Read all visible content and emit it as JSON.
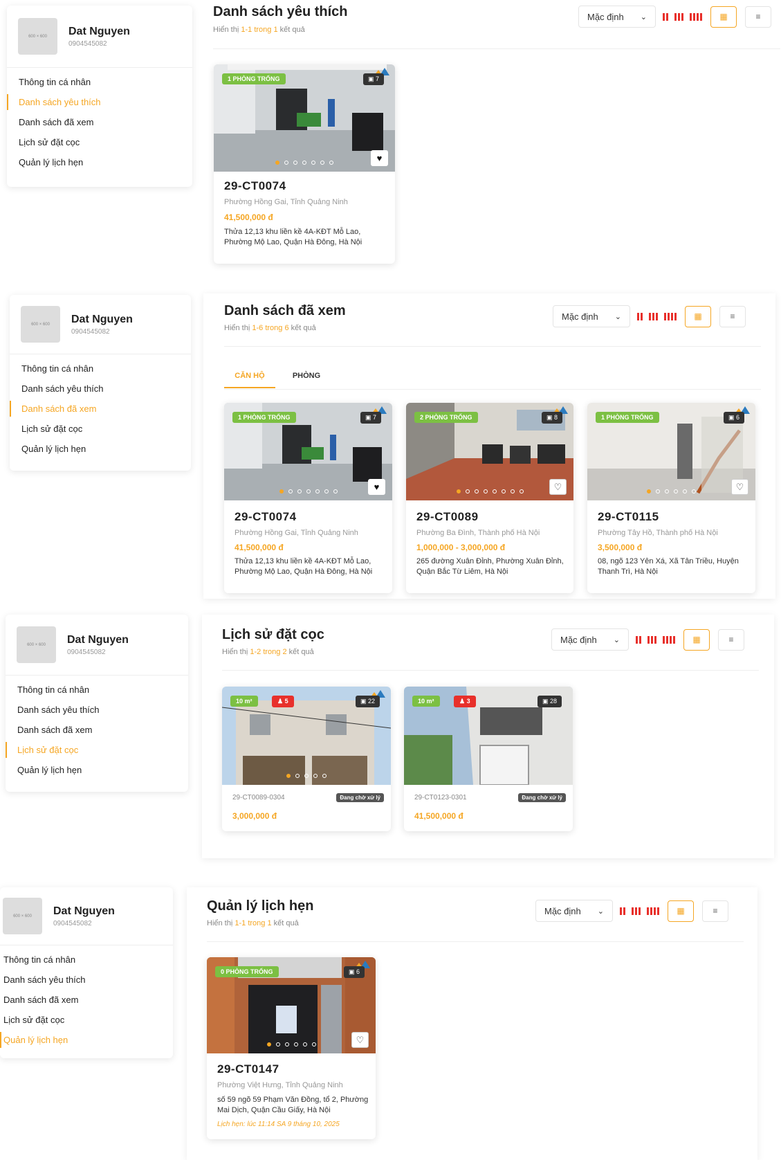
{
  "profile": {
    "name": "Dat Nguyen",
    "phone": "0904545082",
    "avatar_text": "600 × 600"
  },
  "menu": [
    "Thông tin cá nhân",
    "Danh sách yêu thích",
    "Danh sách đã xem",
    "Lịch sử đặt cọc",
    "Quản lý lịch hẹn"
  ],
  "controls": {
    "sort_label": "Mặc định"
  },
  "colors": {
    "accent": "#f5a623",
    "green_badge": "#7cc043",
    "red": "#e8302b"
  },
  "sections": {
    "favorites": {
      "title": "Danh sách yêu thích",
      "result": {
        "prefix": "Hiển thị ",
        "range": "1-1 trong 1",
        "suffix": " kết quả"
      },
      "card": {
        "badge": "1 PHÒNG TRỐNG",
        "photos": "7",
        "code": "29-CT0074",
        "location": "Phường Hồng Gai, Tỉnh Quảng Ninh",
        "price": "41,500,000 đ",
        "address": "Thửa 12,13 khu liền kề 4A-KĐT Mỗ Lao, Phường Mộ Lao, Quận Hà Đông, Hà Nội",
        "favorited": true
      }
    },
    "viewed": {
      "title": "Danh sách đã xem",
      "result": {
        "prefix": "Hiển thị ",
        "range": "1-6 trong 6",
        "suffix": " kết quả"
      },
      "tabs": [
        "CĂN HỘ",
        "PHÒNG"
      ],
      "cards": [
        {
          "badge": "1 PHÒNG TRỐNG",
          "photos": "7",
          "code": "29-CT0074",
          "location": "Phường Hồng Gai, Tỉnh Quảng Ninh",
          "price": "41,500,000 đ",
          "address": "Thửa 12,13 khu liền kề 4A-KĐT Mỗ Lao, Phường Mộ Lao, Quận Hà Đông, Hà Nội",
          "favorited": true
        },
        {
          "badge": "2 PHÒNG TRỐNG",
          "photos": "8",
          "code": "29-CT0089",
          "location": "Phường Ba Đình, Thành phố Hà Nội",
          "price": "1,000,000 - 3,000,000 đ",
          "address": "265 đường Xuân Đỉnh, Phường Xuân Đỉnh, Quận Bắc Từ Liêm, Hà Nội",
          "favorited": false
        },
        {
          "badge": "1 PHÒNG TRỐNG",
          "photos": "6",
          "code": "29-CT0115",
          "location": "Phường Tây Hồ, Thành phố Hà Nội",
          "price": "3,500,000 đ",
          "address": "08, ngõ 123 Yên Xá, Xã Tân Triều, Huyện Thanh Trì, Hà Nội",
          "favorited": false
        }
      ]
    },
    "deposits": {
      "title": "Lịch sử đặt cọc",
      "result": {
        "prefix": "Hiển thị ",
        "range": "1-2 trong 2",
        "suffix": " kết quả"
      },
      "cards": [
        {
          "area": "10 m²",
          "people": "5",
          "photos": "22",
          "code": "29-CT0089-0304",
          "status": "Đang chờ xử lý",
          "price": "3,000,000 đ"
        },
        {
          "area": "10 m²",
          "people": "3",
          "photos": "28",
          "code": "29-CT0123-0301",
          "status": "Đang chờ xử lý",
          "price": "41,500,000 đ"
        }
      ]
    },
    "appointments": {
      "title": "Quản lý lịch hẹn",
      "result": {
        "prefix": "Hiển thị ",
        "range": "1-1 trong 1",
        "suffix": " kết quả"
      },
      "card": {
        "badge": "0 PHÒNG TRỐNG",
        "photos": "6",
        "code": "29-CT0147",
        "location": "Phường Việt Hưng, Tỉnh Quảng Ninh",
        "address": "số 59 ngõ 59 Phạm Văn Đồng, tổ 2, Phường Mai Dịch, Quận Cầu Giấy, Hà Nội",
        "appointment": "Lịch hẹn: lúc 11:14 SA 9 tháng 10, 2025",
        "favorited": false
      }
    }
  }
}
